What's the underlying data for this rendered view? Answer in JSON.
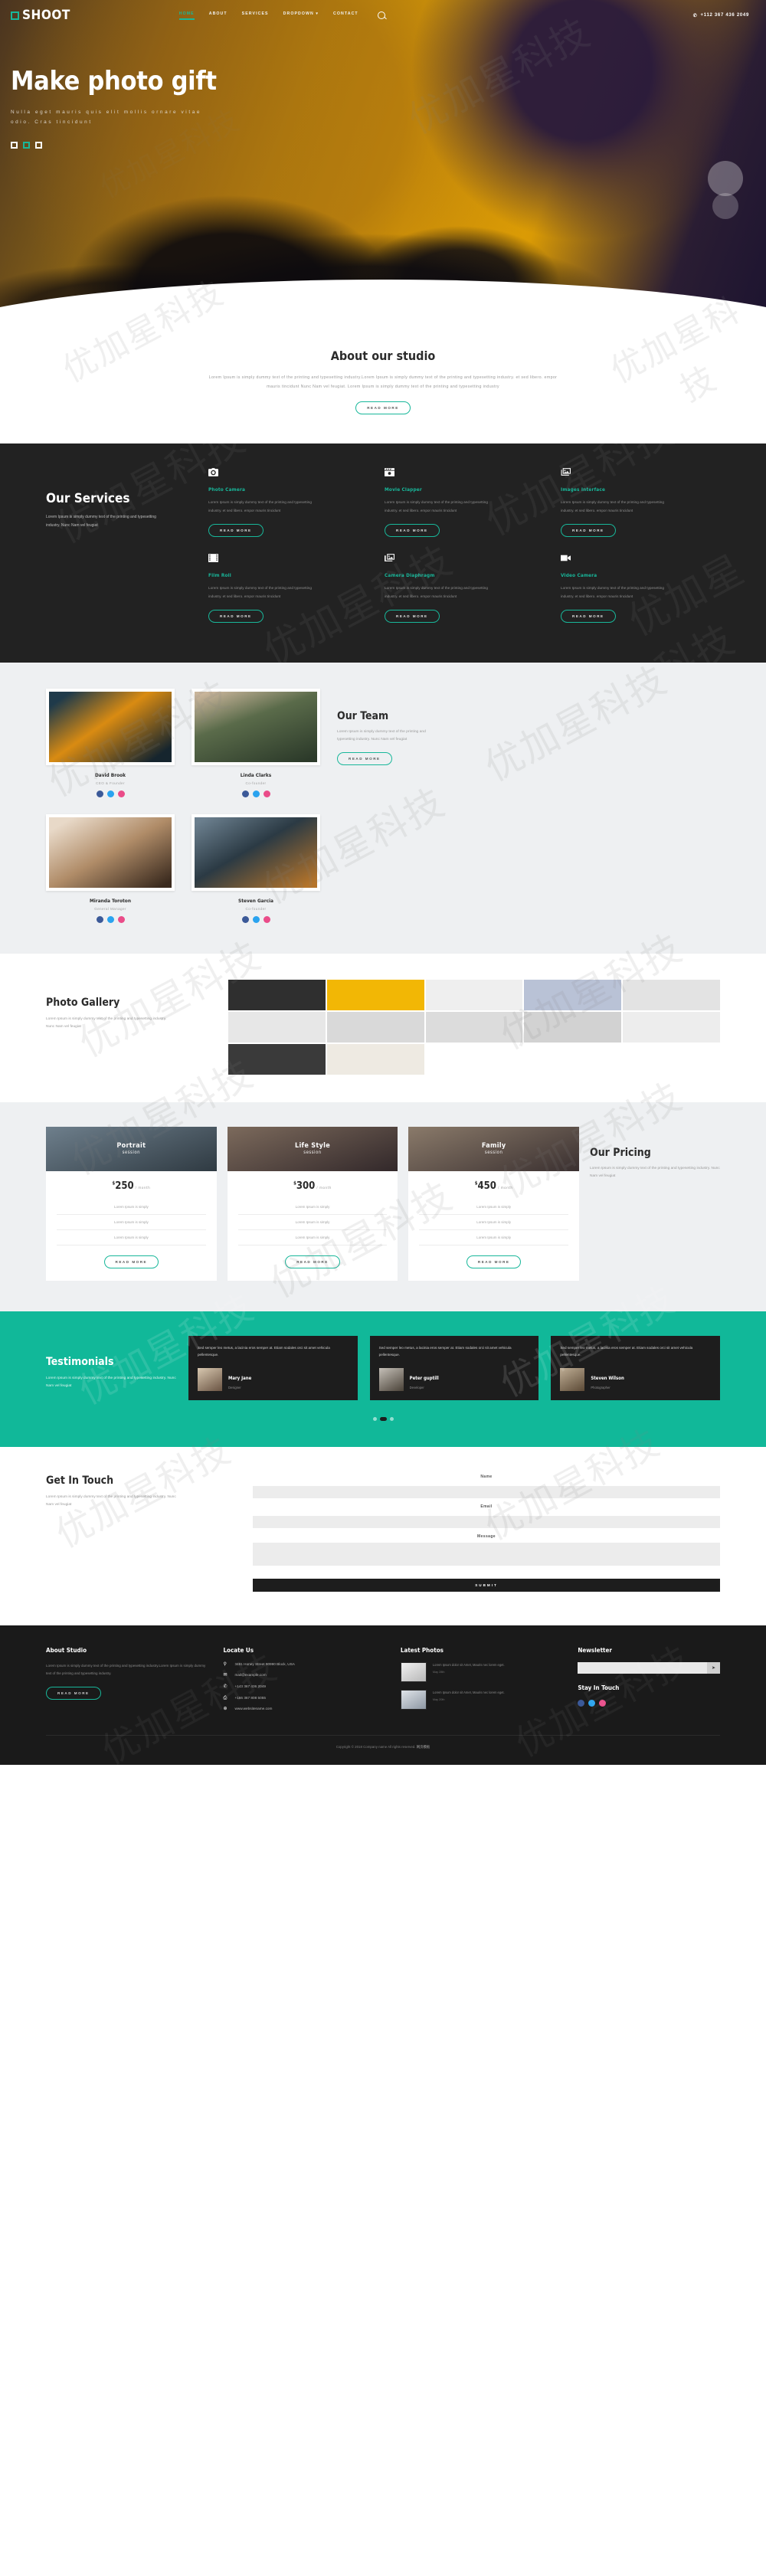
{
  "brand": {
    "name": "SHOOT",
    "mark": "square-outline-icon"
  },
  "nav": {
    "items": [
      {
        "label": "HOME",
        "active": true
      },
      {
        "label": "ABOUT",
        "active": false
      },
      {
        "label": "SERVICES",
        "active": false
      },
      {
        "label": "DROPDOWN",
        "active": false,
        "caret": "▾"
      },
      {
        "label": "CONTACT",
        "active": false
      }
    ],
    "search_icon": "search-icon",
    "phone_icon": "phone-icon",
    "phone": "+112 367 436 2049"
  },
  "hero": {
    "title": "Make photo gift",
    "subtitle": "Nulla eget mauris quis elit mollis ornare vitae odio. Cras tincidunt",
    "slides": [
      {
        "active": false
      },
      {
        "active": true
      },
      {
        "active": false
      }
    ]
  },
  "about": {
    "title": "About our studio",
    "text": "Lorem Ipsum is simply dummy text of the printing and typesetting industry.Lorem Ipsum is simply dummy text of the printing and typesetting industry. et sed libero. empor mauris tincidunt Nunc Nam vel feugiat. Lorem Ipsum is simply dummy text of the printing and typesetting industry",
    "button": "READ MORE"
  },
  "services": {
    "title": "Our Services",
    "intro": "Lorem Ipsum is simply dummy text of the printing and typesetting industry. Nunc Nam vel feugiat",
    "button": "READ MORE",
    "items": [
      {
        "icon": "photo-camera-icon",
        "glyph": "▣",
        "title": "Photo Camera",
        "text": "Lorem Ipsum is simply dummy text of the printing and typesetting industry. et sed libero. empor mauris tincidunt"
      },
      {
        "icon": "movie-clapper-icon",
        "glyph": "▤",
        "title": "Movie Clapper",
        "text": "Lorem Ipsum is simply dummy text of the printing and typesetting industry. et sed libero. empor mauris tincidunt"
      },
      {
        "icon": "images-interface-icon",
        "glyph": "❐",
        "title": "Images Interface",
        "text": "Lorem Ipsum is simply dummy text of the printing and typesetting industry. et sed libero. empor mauris tincidunt"
      },
      {
        "icon": "film-roll-icon",
        "glyph": "⌸",
        "title": "Film Roll",
        "text": "Lorem Ipsum is simply dummy text of the printing and typesetting industry. et sed libero. empor mauris tincidunt"
      },
      {
        "icon": "camera-diaphragm-icon",
        "glyph": "❑",
        "title": "Camera Diaphragm",
        "text": "Lorem Ipsum is simply dummy text of the printing and typesetting industry. et sed libero. empor mauris tincidunt"
      },
      {
        "icon": "video-camera-icon",
        "glyph": "▶",
        "title": "Video Camera",
        "text": "Lorem Ipsum is simply dummy text of the printing and typesetting industry. et sed libero. empor mauris tincidunt"
      }
    ]
  },
  "team": {
    "title": "Our Team",
    "text": "Lorem Ipsum is simply dummy text of the printing and typesetting industry. Nunc Nam vel feugiat",
    "button": "READ MORE",
    "members": [
      {
        "name": "David Brook",
        "role": "CEO & Founder"
      },
      {
        "name": "Linda Clarks",
        "role": "Co-founder"
      },
      {
        "name": "Miranda Toroton",
        "role": "General Manager"
      },
      {
        "name": "Steven Garcia",
        "role": "Co-founder"
      }
    ],
    "social": [
      "facebook-icon",
      "twitter-icon",
      "dribbble-icon"
    ]
  },
  "gallery": {
    "title": "Photo Gallery",
    "text": "Lorem Ipsum is simply dummy text of the printing and typesetting industry. Nunc Nam vel feugiat",
    "tiles": 12
  },
  "pricing": {
    "title": "Our Pricing",
    "text": "Lorem Ipsum is simply dummy text of the printing and typesetting industry. Nunc Nam vel feugiat",
    "session_label": "session",
    "period": "/ month",
    "currency": "$",
    "button": "READ MORE",
    "plans": [
      {
        "name": "Portrait",
        "price": "250",
        "features": [
          "Lorem Ipsum is simply",
          "Lorem Ipsum is simply",
          "Lorem Ipsum is simply"
        ]
      },
      {
        "name": "Life Style",
        "price": "300",
        "features": [
          "Lorem Ipsum is simply",
          "Lorem Ipsum is simply",
          "Lorem Ipsum is simply"
        ]
      },
      {
        "name": "Family",
        "price": "450",
        "features": [
          "Lorem Ipsum is simply",
          "Lorem Ipsum is simply",
          "Lorem Ipsum is simply"
        ]
      }
    ]
  },
  "testimonials": {
    "title": "Testimonials",
    "text": "Lorem Ipsum is simply dummy text of the printing and typesetting industry. Nunc Nam vel feugiat",
    "items": [
      {
        "quote": "Sed semper leo metus, a lacinia eros semper at. Etiam sodales orci sit amet vehicula pellentesque.",
        "name": "Mary Jane",
        "role": "Designer"
      },
      {
        "quote": "Sed semper leo metus, a lacinia eros semper at. Etiam sodales orci sit amet vehicula pellentesque.",
        "name": "Peter guptill",
        "role": "Developer"
      },
      {
        "quote": "Sed semper leo metus, a lacinia eros semper at. Etiam sodales orci sit amet vehicula pellentesque.",
        "name": "Steven Wilson",
        "role": "Photographer"
      }
    ],
    "dots": [
      {
        "active": false
      },
      {
        "active": true
      },
      {
        "active": false
      }
    ]
  },
  "contact": {
    "title": "Get In Touch",
    "text": "Lorem Ipsum is simply dummy text of the printing and typesetting industry. Nunc Nam vel feugiat",
    "fields": [
      {
        "label": "Name",
        "placeholder": ""
      },
      {
        "label": "Email",
        "placeholder": ""
      },
      {
        "label": "Message",
        "placeholder": ""
      }
    ],
    "submit": "SUBMIT"
  },
  "footer": {
    "about": {
      "title": "About Studio",
      "text": "Lorem Ipsum is simply dummy text of the printing and typesetting industry.Lorem Ipsum is simply dummy text of the printing and typesetting industry.",
      "button": "READ MORE"
    },
    "locate": {
      "title": "Locate Us",
      "rows": [
        {
          "icon": "map-pin-icon",
          "glyph": "⦿",
          "text": "3481 Honey Street 90990 Block, USA"
        },
        {
          "icon": "mail-icon",
          "glyph": "✉",
          "text": "mail@example.com"
        },
        {
          "icon": "phone-icon",
          "glyph": "✆",
          "text": "+143 367 436 2049"
        },
        {
          "icon": "fax-icon",
          "glyph": "⎙",
          "text": "+166 367 808 5055"
        },
        {
          "icon": "globe-icon",
          "glyph": "⊕",
          "text": "www.websitename.com"
        }
      ]
    },
    "latest": {
      "title": "Latest Photos",
      "items": [
        {
          "thumb": "vintage-camera-thumb",
          "text": "Lorem Ipsum dolor sit Amet, Mauris nec lorem eget.",
          "date": "May 28th"
        },
        {
          "thumb": "lens-thumb",
          "text": "Lorem Ipsum dolor sit Amet, Mauris nec lorem eget.",
          "date": "May 20th"
        }
      ]
    },
    "newsletter": {
      "title": "Newsletter",
      "placeholder": "",
      "go_icon": "send-icon",
      "touch_title": "Stay In Touch",
      "social": [
        "facebook-icon",
        "twitter-icon",
        "dribbble-icon"
      ]
    },
    "copyright": "Copyright © 2018 Company name All rights reserved.",
    "credit": "网页模板"
  },
  "watermark": "优加星科技"
}
